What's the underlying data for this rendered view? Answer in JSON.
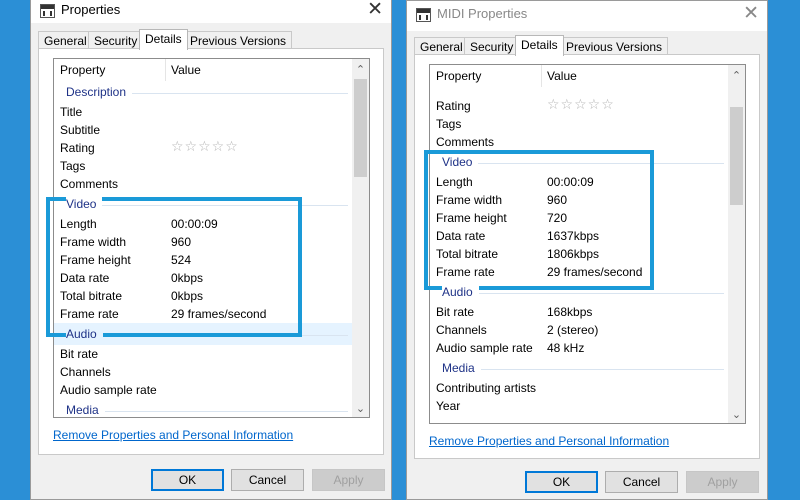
{
  "windows": [
    {
      "title": "Properties",
      "close_glyph": "✕",
      "tabs": [
        "General",
        "Security",
        "Details",
        "Previous Versions"
      ],
      "active_tab": "Details",
      "columns": {
        "property": "Property",
        "value": "Value"
      },
      "groups": {
        "description": "Description",
        "video": "Video",
        "audio": "Audio",
        "media_partial": "Media"
      },
      "description_rows": [
        {
          "k": "Title",
          "v": ""
        },
        {
          "k": "Subtitle",
          "v": ""
        },
        {
          "k": "Rating",
          "v": ""
        },
        {
          "k": "Tags",
          "v": ""
        },
        {
          "k": "Comments",
          "v": ""
        }
      ],
      "rating_stars": "☆☆☆☆☆",
      "video_rows": [
        {
          "k": "Length",
          "v": "00:00:09"
        },
        {
          "k": "Frame width",
          "v": "960"
        },
        {
          "k": "Frame height",
          "v": "524"
        },
        {
          "k": "Data rate",
          "v": "0kbps"
        },
        {
          "k": "Total bitrate",
          "v": "0kbps"
        },
        {
          "k": "Frame rate",
          "v": "29 frames/second"
        }
      ],
      "audio_rows": [
        {
          "k": "Bit rate",
          "v": ""
        },
        {
          "k": "Channels",
          "v": ""
        },
        {
          "k": "Audio sample rate",
          "v": ""
        }
      ],
      "link": "Remove Properties and Personal Information",
      "buttons": {
        "ok": "OK",
        "cancel": "Cancel",
        "apply": "Apply"
      }
    },
    {
      "title": "MIDI Properties",
      "close_glyph": "✕",
      "tabs": [
        "General",
        "Security",
        "Details",
        "Previous Versions"
      ],
      "active_tab": "Details",
      "columns": {
        "property": "Property",
        "value": "Value"
      },
      "groups": {
        "video": "Video",
        "audio": "Audio",
        "media": "Media"
      },
      "top_rows": [
        {
          "k": "Rating",
          "v": ""
        },
        {
          "k": "Tags",
          "v": ""
        },
        {
          "k": "Comments",
          "v": ""
        }
      ],
      "rating_stars": "☆☆☆☆☆",
      "video_rows": [
        {
          "k": "Length",
          "v": "00:00:09"
        },
        {
          "k": "Frame width",
          "v": "960"
        },
        {
          "k": "Frame height",
          "v": "720"
        },
        {
          "k": "Data rate",
          "v": "1637kbps"
        },
        {
          "k": "Total bitrate",
          "v": "1806kbps"
        },
        {
          "k": "Frame rate",
          "v": "29 frames/second"
        }
      ],
      "audio_rows": [
        {
          "k": "Bit rate",
          "v": "168kbps"
        },
        {
          "k": "Channels",
          "v": "2 (stereo)"
        },
        {
          "k": "Audio sample rate",
          "v": "48 kHz"
        }
      ],
      "media_rows": [
        {
          "k": "Contributing artists",
          "v": ""
        },
        {
          "k": "Year",
          "v": ""
        }
      ],
      "link": "Remove Properties and Personal Information",
      "buttons": {
        "ok": "OK",
        "cancel": "Cancel",
        "apply": "Apply"
      }
    }
  ],
  "scroll_arrows": {
    "up": "⌃",
    "down": "⌄"
  },
  "colors": {
    "highlight": "#1a9ad8",
    "desktop": "#2b8fd6",
    "group_text": "#1e3287",
    "link": "#0066cc"
  }
}
